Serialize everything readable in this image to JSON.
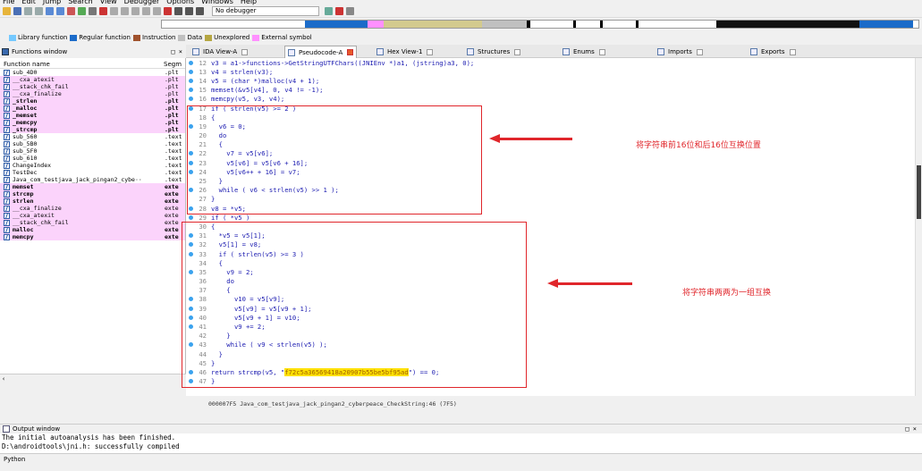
{
  "menu": [
    "File",
    "Edit",
    "Jump",
    "Search",
    "View",
    "Debugger",
    "Options",
    "Windows",
    "Help"
  ],
  "toolbar": {
    "debugger_select": "No debugger"
  },
  "legend": [
    {
      "label": "Library function",
      "color": "#74c9ff"
    },
    {
      "label": "Regular function",
      "color": "#1b6bc9"
    },
    {
      "label": "Instruction",
      "color": "#a0522d"
    },
    {
      "label": "Data",
      "color": "#c0c0c0"
    },
    {
      "label": "Unexplored",
      "color": "#b5a642"
    },
    {
      "label": "External symbol",
      "color": "#ff90ff"
    }
  ],
  "functions_window": {
    "title": "Functions window",
    "col_name": "Function name",
    "col_segment": "Segm",
    "rows": [
      {
        "name": "sub_4D0",
        "seg": ".plt",
        "style": "normal"
      },
      {
        "name": "__cxa_atexit",
        "seg": ".plt",
        "style": "pink"
      },
      {
        "name": "__stack_chk_fail",
        "seg": ".plt",
        "style": "pink"
      },
      {
        "name": "__cxa_finalize",
        "seg": ".plt",
        "style": "pink"
      },
      {
        "name": "_strlen",
        "seg": ".plt",
        "style": "pink-bold"
      },
      {
        "name": "_malloc",
        "seg": ".plt",
        "style": "pink-bold"
      },
      {
        "name": "_memset",
        "seg": ".plt",
        "style": "pink-bold"
      },
      {
        "name": "_memcpy",
        "seg": ".plt",
        "style": "pink-bold"
      },
      {
        "name": "_strcmp",
        "seg": ".plt",
        "style": "pink-bold"
      },
      {
        "name": "sub_560",
        "seg": ".text",
        "style": "normal"
      },
      {
        "name": "sub_5B0",
        "seg": ".text",
        "style": "normal"
      },
      {
        "name": "sub_5F0",
        "seg": ".text",
        "style": "normal"
      },
      {
        "name": "sub_610",
        "seg": ".text",
        "style": "normal"
      },
      {
        "name": "ChangeIndex",
        "seg": ".text",
        "style": "normal"
      },
      {
        "name": "TestDec",
        "seg": ".text",
        "style": "normal"
      },
      {
        "name": "Java_com_testjava_jack_pingan2_cybe··",
        "seg": ".text",
        "style": "normal"
      },
      {
        "name": "memset",
        "seg": "exte",
        "style": "pink-bold"
      },
      {
        "name": "strcmp",
        "seg": "exte",
        "style": "pink-bold"
      },
      {
        "name": "strlen",
        "seg": "exte",
        "style": "pink-bold"
      },
      {
        "name": "__cxa_finalize",
        "seg": "exte",
        "style": "pink"
      },
      {
        "name": "__cxa_atexit",
        "seg": "exte",
        "style": "pink"
      },
      {
        "name": "__stack_chk_fail",
        "seg": "exte",
        "style": "pink"
      },
      {
        "name": "malloc",
        "seg": "exte",
        "style": "pink-bold"
      },
      {
        "name": "memcpy",
        "seg": "exte",
        "style": "pink-bold"
      }
    ]
  },
  "tabs": [
    {
      "label": "IDA View-A",
      "active": false
    },
    {
      "label": "Pseudocode-A",
      "active": true
    },
    {
      "label": "Hex View-1",
      "active": false
    },
    {
      "label": "Structures",
      "active": false
    },
    {
      "label": "Enums",
      "active": false
    },
    {
      "label": "Imports",
      "active": false
    },
    {
      "label": "Exports",
      "active": false
    }
  ],
  "code_lines": [
    {
      "n": "12",
      "dot": true,
      "t": "v3 = a1->functions->GetStringUTFChars((JNIEnv *)a1, (jstring)a3, 0);"
    },
    {
      "n": "13",
      "dot": true,
      "t": "v4 = strlen(v3);"
    },
    {
      "n": "14",
      "dot": true,
      "t": "v5 = (char *)malloc(v4 + 1);"
    },
    {
      "n": "15",
      "dot": true,
      "t": "memset(&v5[v4], 0, v4 != -1);"
    },
    {
      "n": "16",
      "dot": true,
      "t": "memcpy(v5, v3, v4);"
    },
    {
      "n": "17",
      "dot": true,
      "t": "if ( strlen(v5) >= 2 )"
    },
    {
      "n": "18",
      "dot": false,
      "t": "{"
    },
    {
      "n": "19",
      "dot": true,
      "t": "  v6 = 0;"
    },
    {
      "n": "20",
      "dot": false,
      "t": "  do"
    },
    {
      "n": "21",
      "dot": false,
      "t": "  {"
    },
    {
      "n": "22",
      "dot": true,
      "t": "    v7 = v5[v6];"
    },
    {
      "n": "23",
      "dot": true,
      "t": "    v5[v6] = v5[v6 + 16];"
    },
    {
      "n": "24",
      "dot": true,
      "t": "    v5[v6++ + 16] = v7;"
    },
    {
      "n": "25",
      "dot": false,
      "t": "  }"
    },
    {
      "n": "26",
      "dot": true,
      "t": "  while ( v6 < strlen(v5) >> 1 );"
    },
    {
      "n": "27",
      "dot": false,
      "t": "}"
    },
    {
      "n": "28",
      "dot": true,
      "t": "v8 = *v5;"
    },
    {
      "n": "29",
      "dot": true,
      "t": "if ( *v5 )"
    },
    {
      "n": "30",
      "dot": false,
      "t": "{"
    },
    {
      "n": "31",
      "dot": true,
      "t": "  *v5 = v5[1];"
    },
    {
      "n": "32",
      "dot": true,
      "t": "  v5[1] = v8;"
    },
    {
      "n": "33",
      "dot": true,
      "t": "  if ( strlen(v5) >= 3 )"
    },
    {
      "n": "34",
      "dot": false,
      "t": "  {"
    },
    {
      "n": "35",
      "dot": true,
      "t": "    v9 = 2;"
    },
    {
      "n": "36",
      "dot": false,
      "t": "    do"
    },
    {
      "n": "37",
      "dot": false,
      "t": "    {"
    },
    {
      "n": "38",
      "dot": true,
      "t": "      v10 = v5[v9];"
    },
    {
      "n": "39",
      "dot": true,
      "t": "      v5[v9] = v5[v9 + 1];"
    },
    {
      "n": "40",
      "dot": true,
      "t": "      v5[v9 + 1] = v10;"
    },
    {
      "n": "41",
      "dot": true,
      "t": "      v9 += 2;"
    },
    {
      "n": "42",
      "dot": false,
      "t": "    }"
    },
    {
      "n": "43",
      "dot": true,
      "t": "    while ( v9 < strlen(v5) );"
    },
    {
      "n": "44",
      "dot": false,
      "t": "  }"
    },
    {
      "n": "45",
      "dot": false,
      "t": "}"
    }
  ],
  "return_line": {
    "n": "46",
    "pre": "return strcmp(v5, \"",
    "str": "f72c5a36569418a20907b55be5bf95ad",
    "post": "\") == 0;"
  },
  "end_line": {
    "n": "47",
    "t": "}"
  },
  "code_status": "000007F5 Java_com_testjava_jack_pingan2_cyberpeace_CheckString:46 (7F5)",
  "annotations": {
    "a1": "将字符串前16位和后16位互换位置",
    "a2": "将字符串两两为一组互换"
  },
  "output": {
    "title": "Output window",
    "line1": "The initial autoanalysis has been finished.",
    "line2": "D:\\androidtools\\jni.h: successfully compiled",
    "python_label": "Python"
  }
}
